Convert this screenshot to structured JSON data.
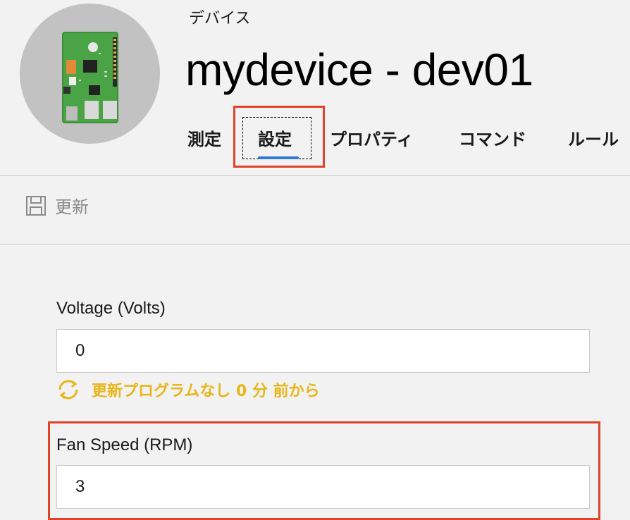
{
  "header": {
    "category": "デバイス",
    "title": "mydevice - dev01",
    "avatar_icon": "raspberry-pi-board-icon"
  },
  "tabs": [
    {
      "label": "測定"
    },
    {
      "label": "設定"
    },
    {
      "label": "プロパティ"
    },
    {
      "label": "コマンド"
    },
    {
      "label": "ルール"
    }
  ],
  "active_tab": "設定",
  "toolbar": {
    "update_label": "更新",
    "update_icon": "save-icon"
  },
  "fields": [
    {
      "label": "Voltage (Volts)",
      "value": "0"
    },
    {
      "label": "Fan Speed (RPM)",
      "value": "3"
    }
  ],
  "sync_status": {
    "text": "更新プログラムなし 0 分 前から",
    "icon": "sync-icon",
    "color": "#e8b619"
  },
  "colors": {
    "accent": "#2f7ad8",
    "highlight": "#e0422a"
  }
}
